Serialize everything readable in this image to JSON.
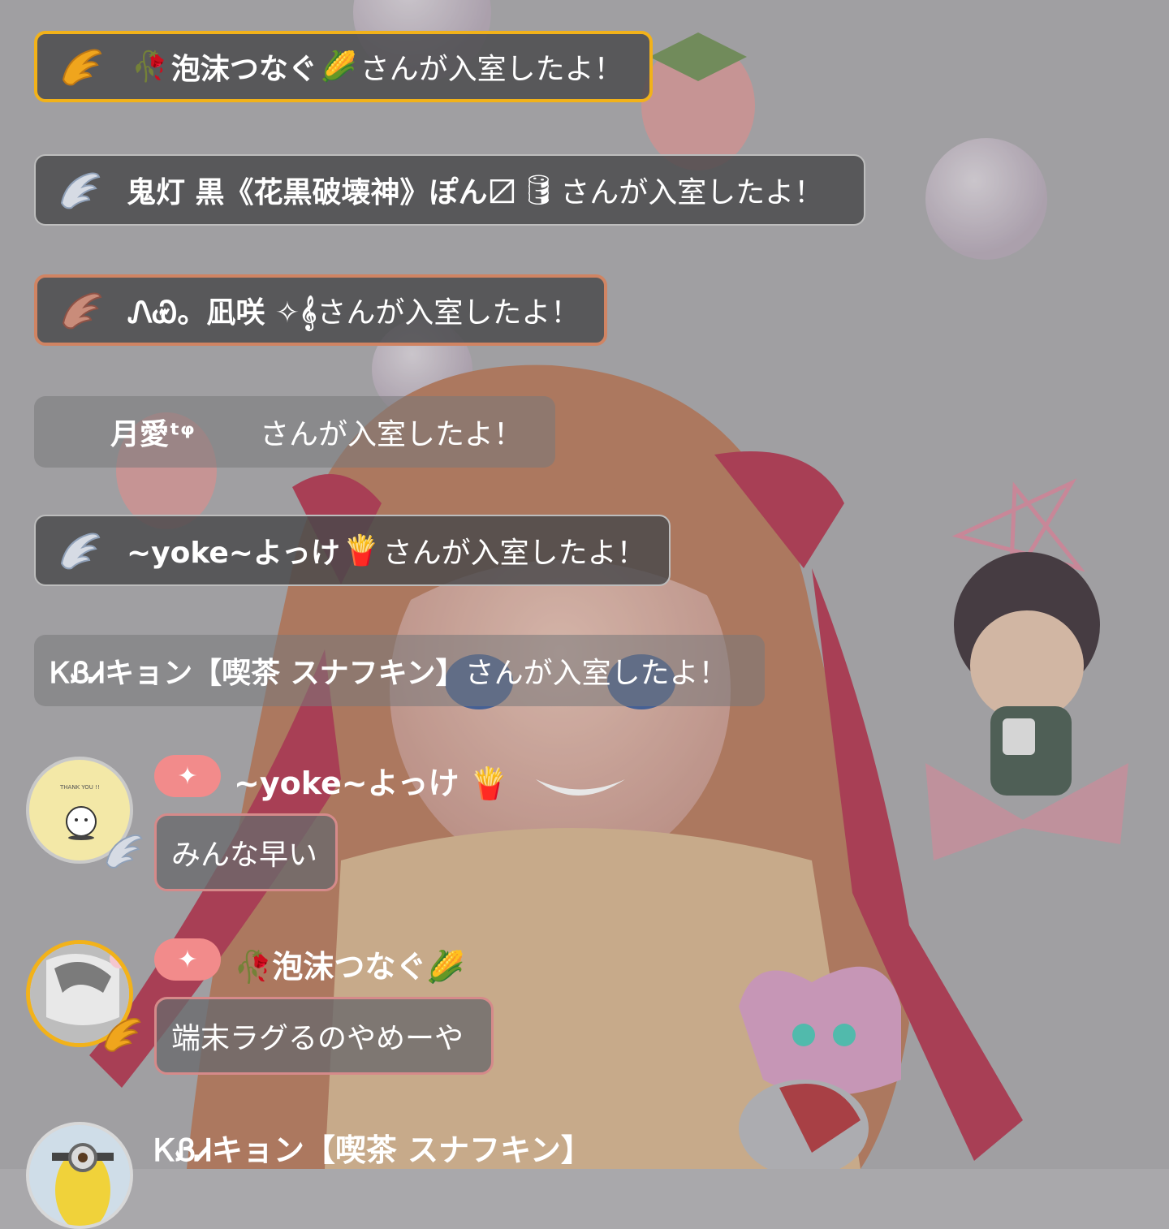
{
  "join_messages": [
    {
      "prefix_emoji": "🥀",
      "name": "泡沫つなぐ",
      "suffix_emoji": "🌽",
      "text": "さんが入室したよ！",
      "badge": "gold-wing-icon"
    },
    {
      "prefix_emoji": "",
      "name": "鬼灯 黒《花黒破壊神》ぽん〼",
      "suffix_emoji": "🛢",
      "text": "さんが入室したよ！",
      "badge": "silver-wing-icon"
    },
    {
      "prefix_emoji": "",
      "name": "ᏁᏯ。凪咲 ✧𝄞",
      "suffix_emoji": "",
      "text": "さんが入室したよ！",
      "badge": "copper-wing-icon"
    },
    {
      "prefix_emoji": "",
      "name": "月愛ᵗᵠ",
      "suffix_emoji": "",
      "text": "さんが入室したよ！",
      "badge": ""
    },
    {
      "prefix_emoji": "",
      "name": "~yoke~よっけ",
      "suffix_emoji": "🍟",
      "text": "さんが入室したよ！",
      "badge": "silver-wing-icon"
    },
    {
      "prefix_emoji": "",
      "name": "ᏦᏰᏗキョン【喫茶 スナフキン】",
      "suffix_emoji": "",
      "text": "さんが入室したよ！",
      "badge": ""
    }
  ],
  "chat_messages": [
    {
      "plus": "✦",
      "name": "~yoke~よっけ 🍟",
      "text": "みんな早い",
      "avatar_caption": "THANK YOU !!"
    },
    {
      "plus": "✦",
      "name": "🥀泡沫つなぐ🌽",
      "text": "端末ラグるのやめーや"
    },
    {
      "name": "ᏦᏰᏗキョン【喫茶 スナフキン】"
    }
  ]
}
